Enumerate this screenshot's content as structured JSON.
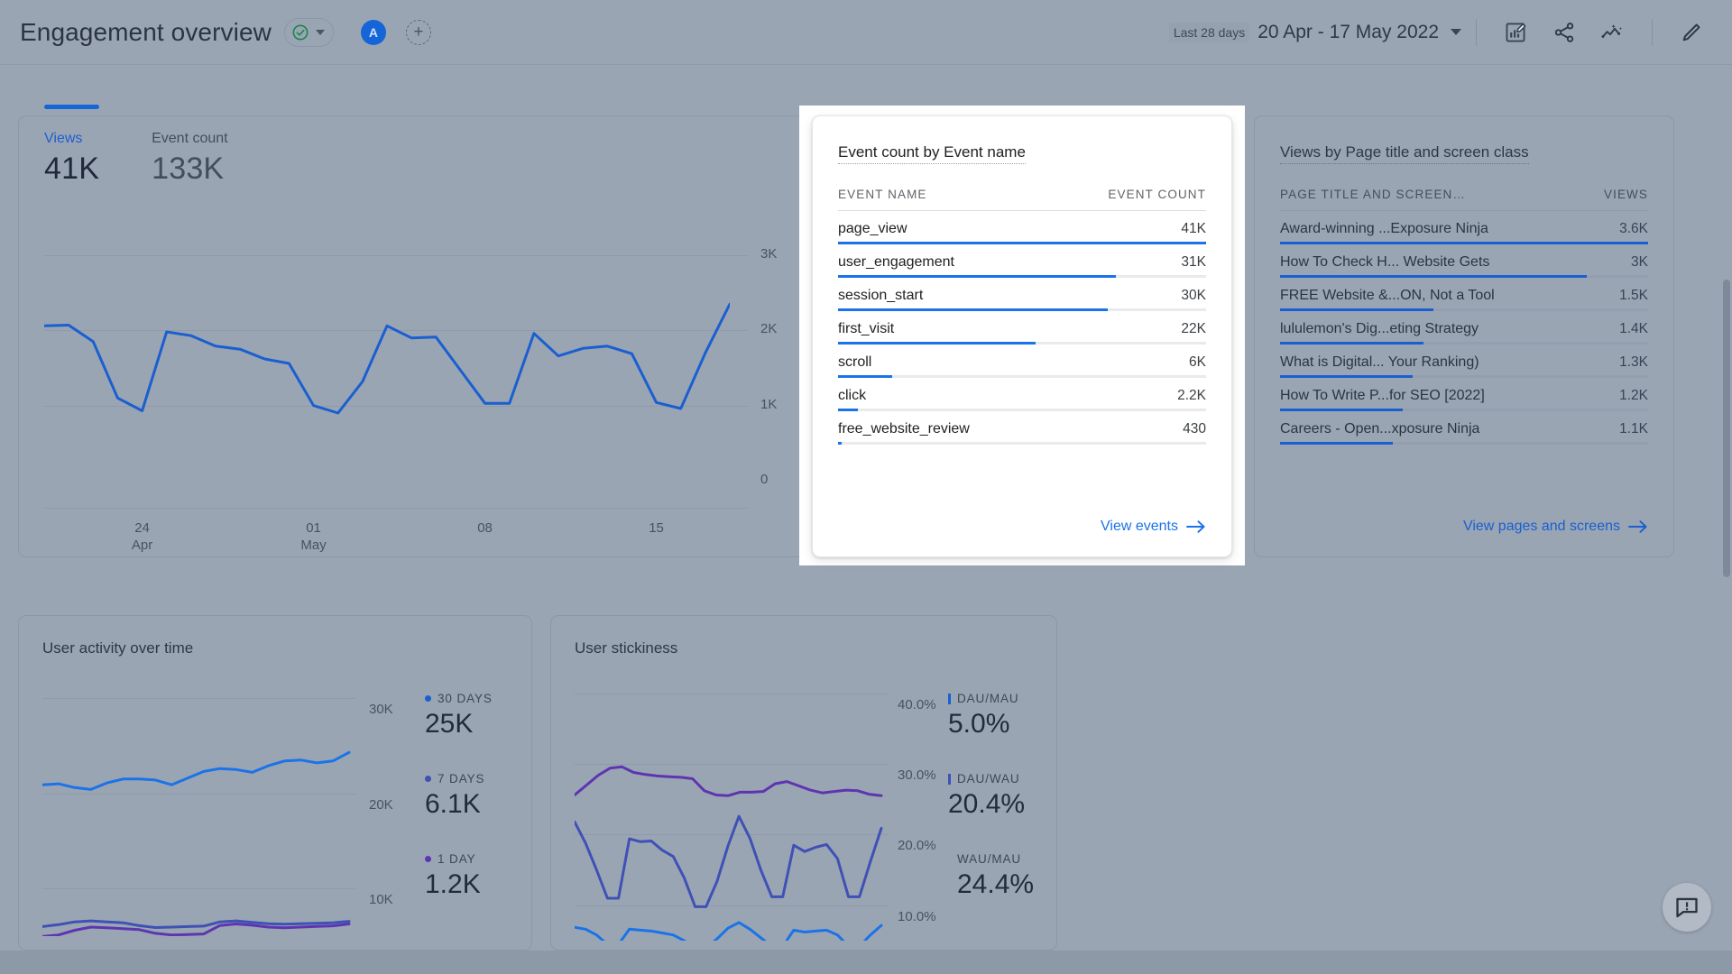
{
  "header": {
    "title": "Engagement overview",
    "status_icon": "check-circle-icon",
    "status_caret_icon": "chevron-down-icon",
    "avatar_initial": "A",
    "add_label": "+",
    "date_badge": "Last 28 days",
    "date_range": "20 Apr - 17 May 2022",
    "date_caret_icon": "chevron-down-icon",
    "icons": [
      {
        "name": "customize-report-icon"
      },
      {
        "name": "share-icon"
      },
      {
        "name": "insights-icon"
      },
      {
        "name": "edit-pencil-icon"
      }
    ]
  },
  "views_card": {
    "tabs": [
      {
        "label": "Views",
        "value": "41K",
        "active": true
      },
      {
        "label": "Event count",
        "value": "133K",
        "active": false
      }
    ]
  },
  "events_card": {
    "title": "Event count by Event name",
    "col_name": "EVENT NAME",
    "col_value": "EVENT COUNT",
    "rows": [
      {
        "name": "page_view",
        "value": "41K",
        "pct": 100
      },
      {
        "name": "user_engagement",
        "value": "31K",
        "pct": 75.6
      },
      {
        "name": "session_start",
        "value": "30K",
        "pct": 73.2
      },
      {
        "name": "first_visit",
        "value": "22K",
        "pct": 53.7
      },
      {
        "name": "scroll",
        "value": "6K",
        "pct": 14.6
      },
      {
        "name": "click",
        "value": "2.2K",
        "pct": 5.4
      },
      {
        "name": "free_website_review",
        "value": "430",
        "pct": 1.0
      }
    ],
    "link": "View events",
    "link_icon": "arrow-right-icon"
  },
  "pages_card": {
    "title": "Views by Page title and screen class",
    "col_name": "PAGE TITLE AND SCREEN…",
    "col_value": "VIEWS",
    "rows": [
      {
        "name": "Award-winning ...Exposure Ninja",
        "value": "3.6K",
        "pct": 100
      },
      {
        "name": "How To Check H... Website Gets",
        "value": "3K",
        "pct": 83.3
      },
      {
        "name": "FREE Website &...ON, Not a Tool",
        "value": "1.5K",
        "pct": 41.7
      },
      {
        "name": "lululemon's Dig...eting Strategy",
        "value": "1.4K",
        "pct": 38.9
      },
      {
        "name": "What is Digital... Your Ranking)",
        "value": "1.3K",
        "pct": 36.1
      },
      {
        "name": "How To Write P...for SEO [2022]",
        "value": "1.2K",
        "pct": 33.3
      },
      {
        "name": "Careers - Open...xposure Ninja",
        "value": "1.1K",
        "pct": 30.6
      }
    ],
    "link": "View pages and screens",
    "link_icon": "arrow-right-icon"
  },
  "activity_card": {
    "title": "User activity over time",
    "metrics": [
      {
        "label": "30 DAYS",
        "value": "25K",
        "marker": "dot",
        "color": "#1a73e8"
      },
      {
        "label": "7 DAYS",
        "value": "6.1K",
        "marker": "dot",
        "color": "#3f51b5"
      },
      {
        "label": "1 DAY",
        "value": "1.2K",
        "marker": "dot",
        "color": "#5e35b1"
      }
    ]
  },
  "stickiness_card": {
    "title": "User stickiness",
    "metrics": [
      {
        "label": "DAU/MAU",
        "value": "5.0%",
        "marker": "tick",
        "color": "#1a73e8"
      },
      {
        "label": "DAU/WAU",
        "value": "20.4%",
        "marker": "tick",
        "color": "#3f51b5"
      },
      {
        "label": "WAU/MAU",
        "value": "24.4%",
        "marker": "none",
        "color": "#5e35b1"
      }
    ]
  },
  "feedback_button": {
    "icon": "feedback-icon"
  },
  "chart_data": [
    {
      "id": "views_over_time",
      "type": "line",
      "title": "Views",
      "xlabel": "",
      "ylabel": "",
      "ylim": [
        0,
        3000
      ],
      "yticks": [
        "0",
        "1K",
        "2K",
        "3K"
      ],
      "ytick_values": [
        0,
        1000,
        2000,
        3000
      ],
      "xticks": [
        {
          "label": "24",
          "sub": "Apr",
          "index": 4
        },
        {
          "label": "01",
          "sub": "May",
          "index": 11
        },
        {
          "label": "08",
          "sub": "",
          "index": 18
        },
        {
          "label": "15",
          "sub": "",
          "index": 25
        }
      ],
      "grid": true,
      "legend": "none",
      "series": [
        {
          "name": "Views",
          "color": "#1a5fd0",
          "values": [
            2060,
            2070,
            1850,
            1100,
            930,
            1980,
            1930,
            1790,
            1750,
            1620,
            1560,
            1000,
            900,
            1320,
            2060,
            1900,
            1910,
            1470,
            1030,
            1030,
            1960,
            1660,
            1760,
            1790,
            1690,
            1040,
            960,
            1700,
            2350
          ]
        }
      ]
    },
    {
      "id": "user_activity_over_time",
      "type": "line",
      "title": "User activity over time",
      "ylim": [
        5000,
        32000
      ],
      "yticks": [
        "30K",
        "20K",
        "10K"
      ],
      "ytick_values": [
        30000,
        20000,
        10000
      ],
      "grid": true,
      "legend": "right",
      "series": [
        {
          "name": "30 DAYS",
          "color": "#1a73e8",
          "latest": "25K",
          "values": [
            20900,
            21000,
            20600,
            20400,
            21100,
            21500,
            21500,
            21400,
            20900,
            21600,
            22300,
            22600,
            22500,
            22200,
            22900,
            23400,
            23500,
            23200,
            23400,
            24300
          ]
        },
        {
          "name": "7 DAYS",
          "color": "#3f51b5",
          "latest": "6.1K",
          "values": [
            6000,
            6200,
            6500,
            6600,
            6500,
            6400,
            6100,
            5900,
            5950,
            6000,
            6050,
            6500,
            6600,
            6450,
            6300,
            6250,
            6300,
            6350,
            6400,
            6550
          ]
        },
        {
          "name": "1 DAY",
          "color": "#5e35b1",
          "latest": "1.2K",
          "values": []
        }
      ]
    },
    {
      "id": "user_stickiness",
      "type": "line",
      "title": "User stickiness",
      "ylim": [
        5,
        42
      ],
      "yticks": [
        "40.0%",
        "30.0%",
        "20.0%",
        "10.0%"
      ],
      "ytick_values": [
        40,
        30,
        20,
        10
      ],
      "grid": true,
      "legend": "right",
      "series": [
        {
          "name": "WAU/MAU",
          "color": "#5e35b1",
          "latest": "24.4%",
          "values": [
            25.6,
            27.0,
            28.4,
            29.4,
            29.6,
            28.8,
            28.5,
            28.3,
            28.2,
            28.1,
            27.9,
            26.2,
            25.6,
            25.5,
            26.0,
            26.0,
            26.1,
            27.2,
            27.5,
            26.9,
            26.3,
            25.9,
            26.1,
            26.3,
            26.2,
            25.7,
            25.5
          ]
        },
        {
          "name": "DAU/WAU",
          "color": "#3f51b5",
          "latest": "20.4%",
          "values": [
            21.8,
            18.8,
            15.0,
            11.0,
            11.0,
            19.4,
            19.0,
            19.1,
            17.8,
            16.9,
            13.9,
            9.8,
            9.8,
            13.4,
            18.4,
            22.6,
            19.5,
            15.0,
            11.2,
            11.2,
            18.5,
            17.6,
            18.2,
            18.6,
            16.6,
            11.2,
            11.2,
            16.2,
            20.9
          ]
        },
        {
          "name": "DAU/MAU",
          "color": "#1a73e8",
          "latest": "5.0%",
          "values": []
        }
      ]
    }
  ]
}
